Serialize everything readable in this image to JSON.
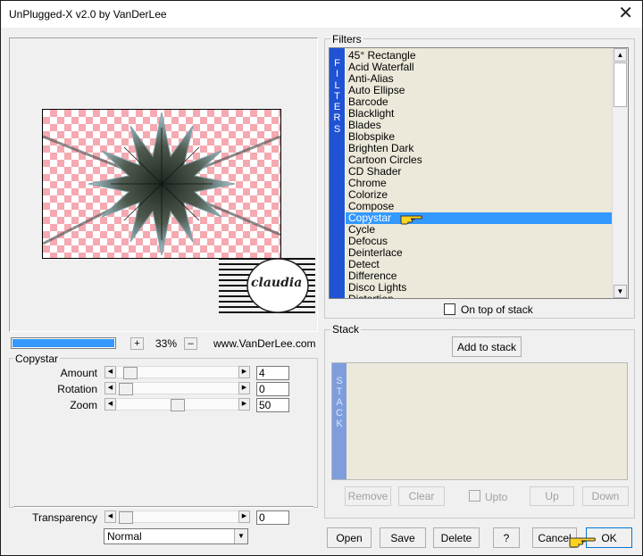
{
  "window": {
    "title": "UnPlugged-X v2.0 by VanDerLee",
    "close_glyph": "✕"
  },
  "filters": {
    "group_label": "Filters",
    "strip_letters": [
      "F",
      "I",
      "L",
      "T",
      "E",
      "R",
      "S"
    ],
    "items": [
      "45° Rectangle",
      "Acid Waterfall",
      "Anti-Alias",
      "Auto Ellipse",
      "Barcode",
      "Blacklight",
      "Blades",
      "Blobspike",
      "Brighten Dark",
      "Cartoon Circles",
      "CD Shader",
      "Chrome",
      "Colorize",
      "Compose",
      "Copystar",
      "Cycle",
      "Defocus",
      "Deinterlace",
      "Detect",
      "Difference",
      "Disco Lights",
      "Distortion"
    ],
    "selected_index": 14,
    "on_top_label": "On top of stack",
    "on_top_checked": false
  },
  "stack": {
    "group_label": "Stack",
    "add_button": "Add to stack",
    "strip_letters": [
      "S",
      "T",
      "A",
      "C",
      "K"
    ],
    "buttons": {
      "remove": "Remove",
      "clear": "Clear",
      "upto": "Upto",
      "up": "Up",
      "down": "Down"
    },
    "upto_checked": false
  },
  "preview": {
    "watermark": "claudia",
    "zoom_plus": "+",
    "zoom_minus": "–",
    "zoom_level": "33%",
    "website": "www.VanDerLee.com",
    "progress_percent": 100
  },
  "params": {
    "group_label": "Copystar",
    "sliders": [
      {
        "label": "Amount",
        "value": "4",
        "fraction": 0.04
      },
      {
        "label": "Rotation",
        "value": "0",
        "fraction": 0.0
      },
      {
        "label": "Zoom",
        "value": "50",
        "fraction": 0.5
      }
    ],
    "transparency": {
      "label": "Transparency",
      "value": "0",
      "fraction": 0.0
    },
    "blend_mode": "Normal"
  },
  "buttons": {
    "open": "Open",
    "save": "Save",
    "delete": "Delete",
    "help": "?",
    "cancel": "Cancel",
    "ok": "OK"
  },
  "colors": {
    "accent": "#3399ff",
    "filter_strip": "#2052d4",
    "checker_pink": "#f5a9b0"
  }
}
